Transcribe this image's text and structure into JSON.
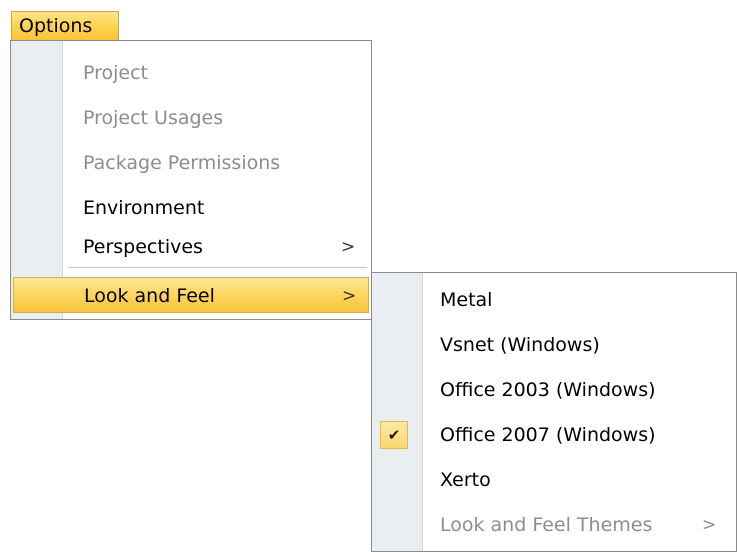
{
  "menubar": {
    "title": "Options"
  },
  "options_menu": {
    "items": [
      {
        "label": "Project",
        "enabled": false
      },
      {
        "label": "Project Usages",
        "enabled": false
      },
      {
        "label": "Package Permissions",
        "enabled": false
      },
      {
        "label": "Environment",
        "enabled": true
      },
      {
        "label": "Perspectives",
        "enabled": true,
        "submenu_arrow": ">"
      },
      {
        "label": "Look and Feel",
        "enabled": true,
        "submenu_arrow": ">",
        "highlighted": true
      }
    ]
  },
  "look_and_feel_menu": {
    "items": [
      {
        "label": "Metal",
        "enabled": true
      },
      {
        "label": "Vsnet (Windows)",
        "enabled": true
      },
      {
        "label": "Office 2003 (Windows)",
        "enabled": true
      },
      {
        "label": "Office 2007 (Windows)",
        "enabled": true,
        "checked": true,
        "check_glyph": "✔"
      },
      {
        "label": "Xerto",
        "enabled": true
      },
      {
        "label": "Look and Feel Themes",
        "enabled": false,
        "submenu_arrow": ">"
      }
    ]
  },
  "colors": {
    "highlight": "#fdd55e",
    "gutter": "#e9eef0",
    "disabled_text": "#8d8d8d",
    "border": "#8a8a8a"
  }
}
